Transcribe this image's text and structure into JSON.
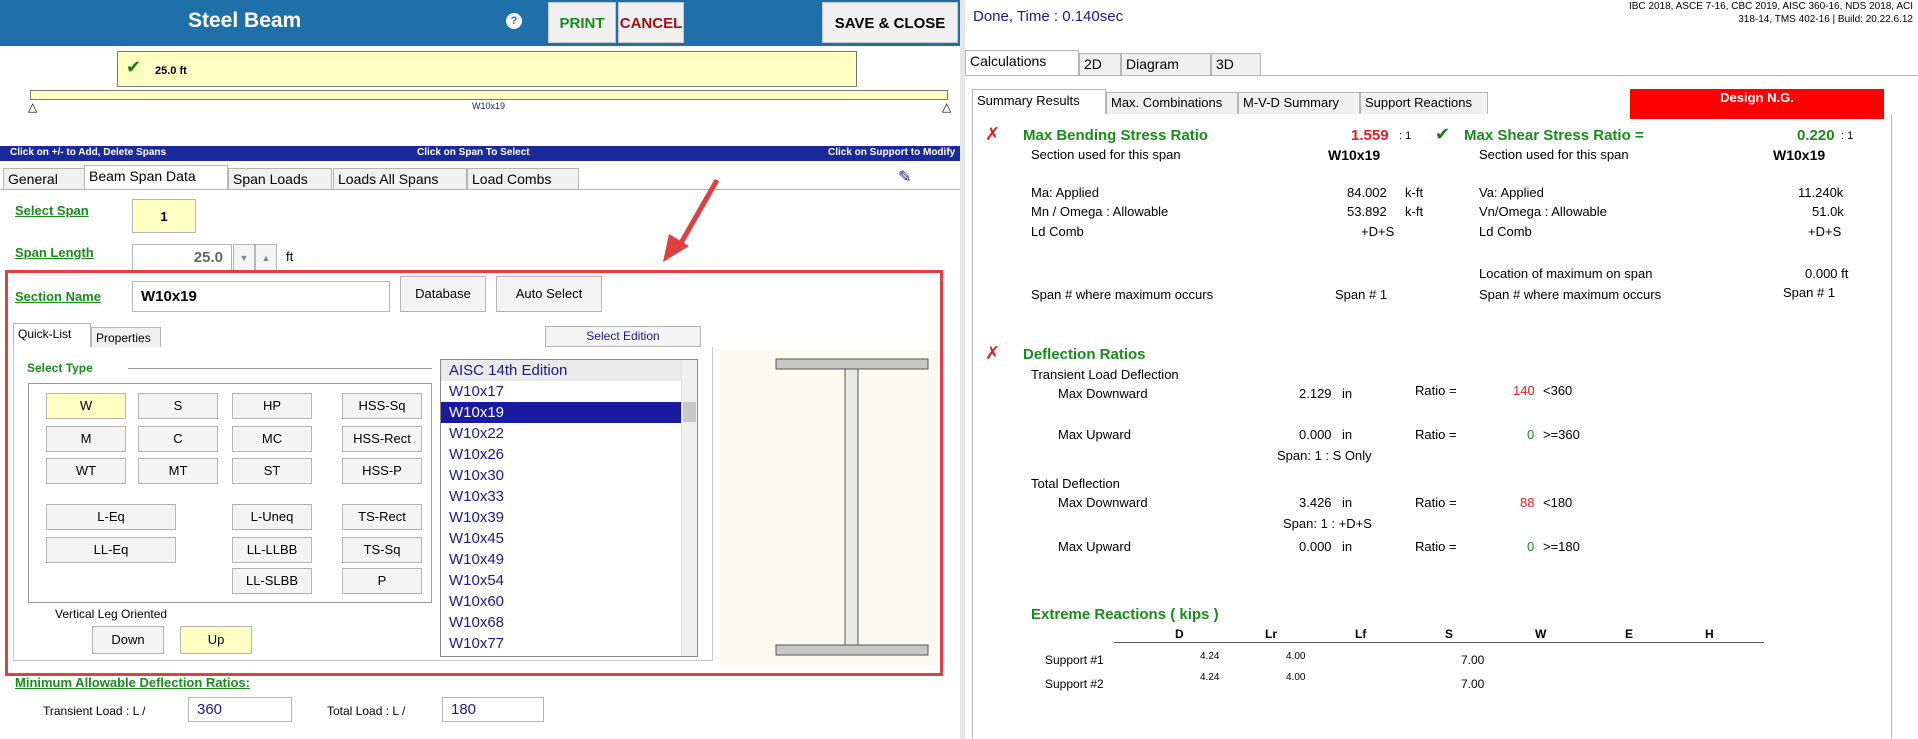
{
  "left": {
    "title": "Steel Beam",
    "help_glyph": "?",
    "print_label": "PRINT",
    "cancel_label": "CANCEL",
    "save_close_label": "SAVE & CLOSE",
    "span_label": "25.0 ft",
    "beam_name": "W10x19",
    "hint_add": "Click on +/-  to Add, Delete Spans",
    "hint_select": "Click on Span To Select",
    "hint_support": "Click on Support to Modify",
    "tabs": [
      "General",
      "Beam Span Data",
      "Span Loads",
      "Loads All Spans",
      "Load Combs"
    ],
    "select_span_label": "Select Span",
    "select_span_value": "1",
    "span_length_label": "Span Length",
    "span_length_value": "25.0",
    "span_length_unit": "ft",
    "section_name_label": "Section Name",
    "section_name_value": "W10x19",
    "database_label": "Database",
    "auto_select_label": "Auto Select",
    "sub_tabs": [
      "Quick-List",
      "Properties"
    ],
    "select_edition_label": "Select Edition",
    "select_type_label": "Select Type",
    "types": [
      "W",
      "S",
      "HP",
      "HSS-Sq",
      "M",
      "C",
      "MC",
      "HSS-Rect",
      "WT",
      "MT",
      "ST",
      "HSS-P",
      "L-Eq",
      "L-Uneq",
      "TS-Rect",
      "LL-Eq",
      "LL-LLBB",
      "TS-Sq",
      "LL-SLBB",
      "P"
    ],
    "vertical_leg_label": "Vertical Leg Oriented",
    "down_label": "Down",
    "up_label": "Up",
    "list_header": "AISC 14th Edition",
    "list_items": [
      "W10x17",
      "W10x19",
      "W10x22",
      "W10x26",
      "W10x30",
      "W10x33",
      "W10x39",
      "W10x45",
      "W10x49",
      "W10x54",
      "W10x60",
      "W10x68",
      "W10x77"
    ],
    "selected_item": "W10x19",
    "min_defl_label": "Minimum Allowable Deflection Ratios:",
    "transient_label": "Transient Load :   L /",
    "transient_value": "360",
    "total_label": "Total Load :   L /",
    "total_value": "180"
  },
  "right": {
    "done_time": "Done, Time :  0.140sec",
    "codes_line1": "IBC 2018, ASCE 7-16, CBC 2019, AISC 360-16, NDS 2018, ACI",
    "codes_line2": "318-14, TMS 402-16 | Build: 20.22.6.12",
    "main_tabs": [
      "Calculations",
      "2D",
      "Diagram",
      "3D"
    ],
    "sub_tabs": [
      "Summary Results",
      "Max. Combinations",
      "M-V-D Summary",
      "Support Reactions"
    ],
    "design_status": "Design N.G.",
    "bending": {
      "title": "Max Bending Stress Ratio",
      "ratio": "1.559",
      "ratio_suffix": ": 1",
      "section_label": "Section used for this span",
      "section": "W10x19",
      "ma_label": "Ma: Applied",
      "ma_value": "84.002",
      "ma_unit": "k-ft",
      "mn_label": "Mn / Omega : Allowable",
      "mn_value": "53.892",
      "mn_unit": "k-ft",
      "ld_label": "Ld Comb",
      "ld_value": "+D+S",
      "span_label": "Span # where maximum occurs",
      "span_value": "Span # 1"
    },
    "shear": {
      "title": "Max Shear Stress Ratio =",
      "ratio": "0.220",
      "ratio_suffix": ": 1",
      "section_label": "Section used for this span",
      "section": "W10x19",
      "va_label": "Va: Applied",
      "va_value": "11.240k",
      "vn_label": "Vn/Omega : Allowable",
      "vn_value": "51.0k",
      "ld_label": "Ld Comb",
      "ld_value": "+D+S",
      "loc_label": "Location of maximum on span",
      "loc_value": "0.000 ft",
      "span_label": "Span # where maximum occurs",
      "span_value": "Span # 1"
    },
    "deflection": {
      "title": "Deflection Ratios",
      "transient_label": "Transient Load Deflection",
      "total_label": "Total Deflection",
      "max_down": "Max Downward",
      "max_up": "Max Upward",
      "ratio_label": "Ratio =",
      "t_down_value": "2.129",
      "t_down_ratio": "140",
      "t_down_limit": "<360",
      "t_up_value": "0.000",
      "t_up_ratio": "0",
      "t_up_limit": ">=360",
      "t_span": "Span: 1 : S Only",
      "tot_down_value": "3.426",
      "tot_down_ratio": "88",
      "tot_down_limit": "<180",
      "tot_span": "Span: 1 : +D+S",
      "tot_up_value": "0.000",
      "tot_up_ratio": "0",
      "tot_up_limit": ">=180",
      "unit": "in"
    },
    "reactions": {
      "title": "Extreme Reactions  ( kips )",
      "headers": [
        "D",
        "Lr",
        "Lf",
        "S",
        "W",
        "E",
        "H"
      ],
      "rows": [
        {
          "label": "Support #1",
          "D": "4.24",
          "Lr": "4.00",
          "S": "7.00"
        },
        {
          "label": "Support #2",
          "D": "4.24",
          "Lr": "4.00",
          "S": "7.00"
        }
      ]
    }
  },
  "colors": {
    "title_bar": "#1f6fa8",
    "ng_red": "#ff0000",
    "ok_green": "#1a8a1a",
    "highlight_box": "#e04040"
  }
}
